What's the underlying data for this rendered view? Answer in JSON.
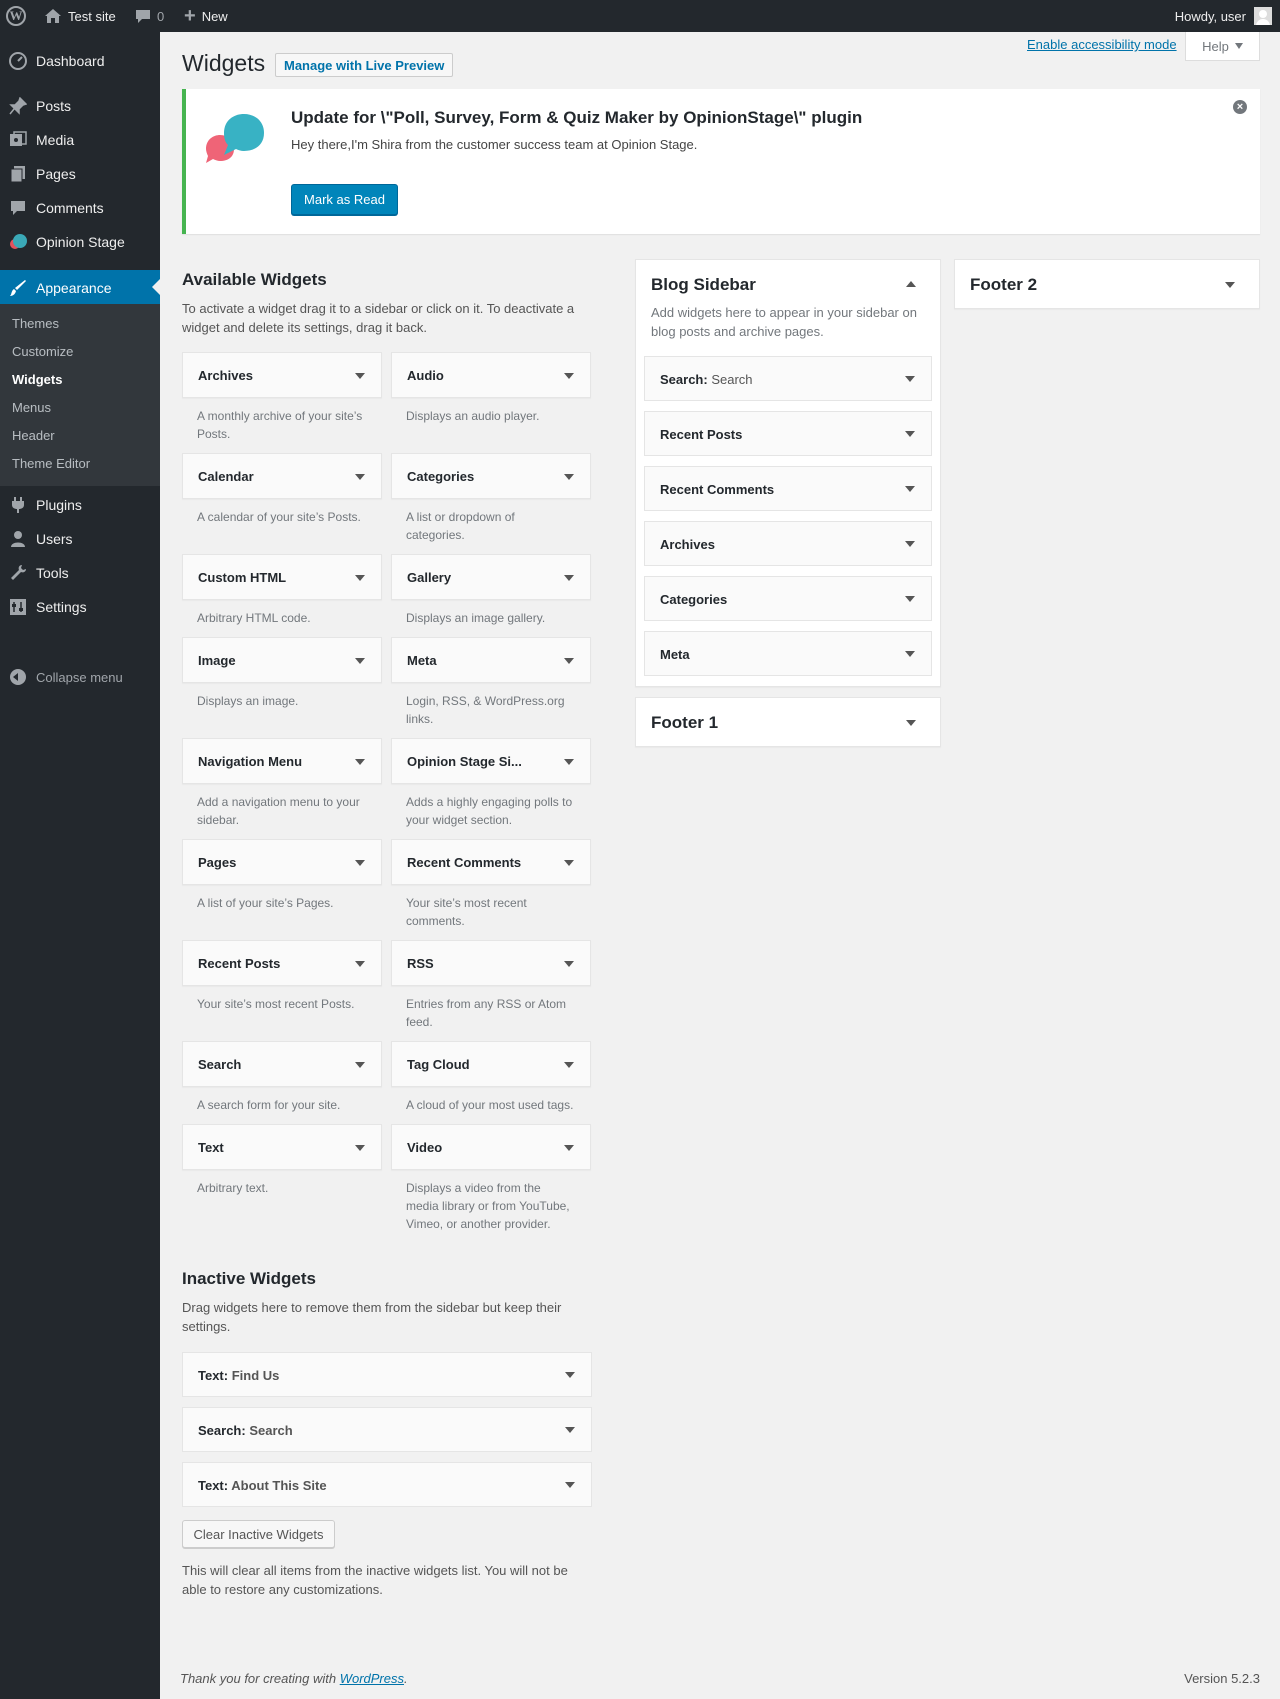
{
  "admin_bar": {
    "site_name": "Test site",
    "comments_count": "0",
    "new_label": "New",
    "howdy": "Howdy, user"
  },
  "sidebar": {
    "items": [
      {
        "label": "Dashboard",
        "icon": "dashboard-icon"
      },
      {
        "label": "Posts",
        "icon": "pushpin-icon"
      },
      {
        "label": "Media",
        "icon": "media-icon"
      },
      {
        "label": "Pages",
        "icon": "pages-icon"
      },
      {
        "label": "Comments",
        "icon": "comments-icon"
      },
      {
        "label": "Opinion Stage",
        "icon": "opinion-stage-icon"
      },
      {
        "label": "Appearance",
        "icon": "paintbrush-icon"
      },
      {
        "label": "Plugins",
        "icon": "plugins-icon"
      },
      {
        "label": "Users",
        "icon": "users-icon"
      },
      {
        "label": "Tools",
        "icon": "tools-icon"
      },
      {
        "label": "Settings",
        "icon": "settings-icon"
      }
    ],
    "submenu": [
      "Themes",
      "Customize",
      "Widgets",
      "Menus",
      "Header",
      "Theme Editor"
    ],
    "collapse_label": "Collapse menu"
  },
  "page": {
    "title": "Widgets",
    "live_preview": "Manage with Live Preview",
    "accessibility_link": "Enable accessibility mode",
    "help": "Help"
  },
  "notice": {
    "title": "Update for \\\"Poll, Survey, Form & Quiz Maker by OpinionStage\\\" plugin",
    "text": "Hey there,I'm Shira from the customer success team at Opinion Stage.",
    "button": "Mark as Read"
  },
  "available": {
    "title": "Available Widgets",
    "description": "To activate a widget drag it to a sidebar or click on it. To deactivate a widget and delete its settings, drag it back.",
    "widgets": [
      {
        "name": "Archives",
        "desc": "A monthly archive of your site’s Posts."
      },
      {
        "name": "Audio",
        "desc": "Displays an audio player."
      },
      {
        "name": "Calendar",
        "desc": "A calendar of your site’s Posts."
      },
      {
        "name": "Categories",
        "desc": "A list or dropdown of categories."
      },
      {
        "name": "Custom HTML",
        "desc": "Arbitrary HTML code."
      },
      {
        "name": "Gallery",
        "desc": "Displays an image gallery."
      },
      {
        "name": "Image",
        "desc": "Displays an image."
      },
      {
        "name": "Meta",
        "desc": "Login, RSS, & WordPress.org links."
      },
      {
        "name": "Navigation Menu",
        "desc": "Add a navigation menu to your sidebar."
      },
      {
        "name": "Opinion Stage Si...",
        "desc": "Adds a highly engaging polls to your widget section."
      },
      {
        "name": "Pages",
        "desc": "A list of your site’s Pages."
      },
      {
        "name": "Recent Comments",
        "desc": "Your site’s most recent comments."
      },
      {
        "name": "Recent Posts",
        "desc": "Your site’s most recent Posts."
      },
      {
        "name": "RSS",
        "desc": "Entries from any RSS or Atom feed."
      },
      {
        "name": "Search",
        "desc": "A search form for your site."
      },
      {
        "name": "Tag Cloud",
        "desc": "A cloud of your most used tags."
      },
      {
        "name": "Text",
        "desc": "Arbitrary text."
      },
      {
        "name": "Video",
        "desc": "Displays a video from the media library or from YouTube, Vimeo, or another provider."
      }
    ]
  },
  "blog_sidebar": {
    "title": "Blog Sidebar",
    "description": "Add widgets here to appear in your sidebar on blog posts and archive pages.",
    "widgets": [
      {
        "name": "Search:",
        "sub": "Search"
      },
      {
        "name": "Recent Posts",
        "sub": ""
      },
      {
        "name": "Recent Comments",
        "sub": ""
      },
      {
        "name": "Archives",
        "sub": ""
      },
      {
        "name": "Categories",
        "sub": ""
      },
      {
        "name": "Meta",
        "sub": ""
      }
    ]
  },
  "footer1": {
    "title": "Footer 1"
  },
  "footer2": {
    "title": "Footer 2"
  },
  "inactive": {
    "title": "Inactive Widgets",
    "description": "Drag widgets here to remove them from the sidebar but keep their settings.",
    "widgets": [
      {
        "name": "Text:",
        "sub": "Find Us"
      },
      {
        "name": "Search:",
        "sub": "Search"
      },
      {
        "name": "Text:",
        "sub": "About This Site"
      }
    ],
    "clear_button": "Clear Inactive Widgets",
    "clear_note": "This will clear all items from the inactive widgets list. You will not be able to restore any customizations."
  },
  "footer": {
    "thanks_before": "Thank you for creating with ",
    "thanks_link": "WordPress",
    "thanks_after": ".",
    "version": "Version 5.2.3"
  }
}
